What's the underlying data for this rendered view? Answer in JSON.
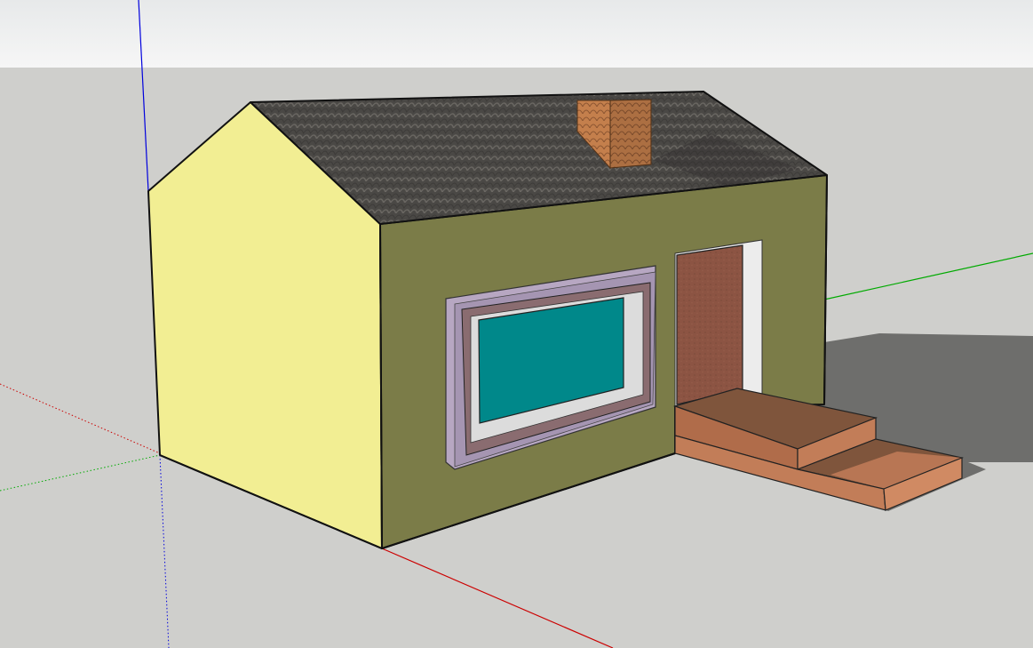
{
  "viewport": {
    "sky_color": "#f0f1f1",
    "ground_color": "#cfcfcc"
  },
  "axes": {
    "red_color": "#cc0000",
    "green_color": "#00aa00",
    "blue_color": "#0000dd"
  },
  "model": {
    "front_wall_color": "#7b7c48",
    "side_wall_color": "#f2ee93",
    "roof_color": "#4a4845",
    "chimney_color": "#c47f4c",
    "window_frame_color": "#b7a7c2",
    "window_sash_color": "#8a6c70",
    "window_glass_color": "#00888a",
    "door_color": "#8c5443",
    "door_jamb_color": "#ececec",
    "step_top_color": "#7f553c",
    "step_front_color": "#c27d58",
    "shadow_color": "#6e6e6c"
  }
}
